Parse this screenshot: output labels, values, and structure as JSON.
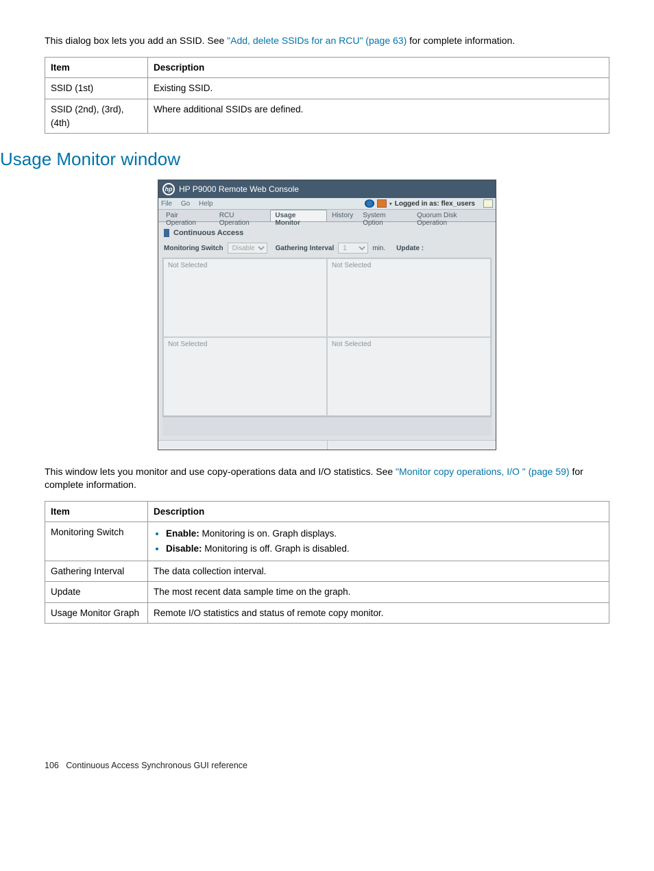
{
  "intro": {
    "pre": "This dialog box lets you add an SSID. See ",
    "link": "\"Add, delete SSIDs for an RCU\" (page 63)",
    "post": " for complete information."
  },
  "table1": {
    "headers": {
      "item": "Item",
      "desc": "Description"
    },
    "rows": [
      {
        "item": "SSID (1st)",
        "desc": "Existing SSID."
      },
      {
        "item": "SSID (2nd), (3rd), (4th)",
        "desc": "Where additional SSIDs are defined."
      }
    ]
  },
  "section_title": "Usage Monitor window",
  "shot": {
    "title": "HP P9000 Remote Web Console",
    "menus": [
      "File",
      "Go",
      "Help"
    ],
    "login": "Logged in as: flex_users",
    "tabs": [
      "Pair Operation",
      "RCU Operation",
      "Usage Monitor",
      "History",
      "System Option",
      "Quorum Disk Operation"
    ],
    "active_tab_index": 2,
    "ca_title": "Continuous Access",
    "toolbar": {
      "mon_label": "Monitoring Switch",
      "mon_value": "Disable",
      "gi_label": "Gathering Interval",
      "gi_value": "1",
      "gi_unit": "min.",
      "update_label": "Update :"
    },
    "panel_text": "Not Selected"
  },
  "intro2": {
    "pre": "This window lets you monitor and use copy-operations data and I/O statistics. See ",
    "link": "\"Monitor copy operations, I/O \" (page 59)",
    "post": " for complete information."
  },
  "table2": {
    "headers": {
      "item": "Item",
      "desc": "Description"
    },
    "rows": [
      {
        "item": "Monitoring Switch",
        "desc": null,
        "bullets": [
          {
            "b": "Enable:",
            "t": " Monitoring is on. Graph displays."
          },
          {
            "b": "Disable:",
            "t": " Monitoring is off. Graph is disabled."
          }
        ]
      },
      {
        "item": "Gathering Interval",
        "desc": "The data collection interval."
      },
      {
        "item": "Update",
        "desc": "The most recent data sample time on the graph."
      },
      {
        "item": "Usage Monitor Graph",
        "desc": "Remote I/O statistics and status of remote copy monitor."
      }
    ]
  },
  "footer": {
    "page": "106",
    "text": "Continuous Access Synchronous GUI reference"
  }
}
